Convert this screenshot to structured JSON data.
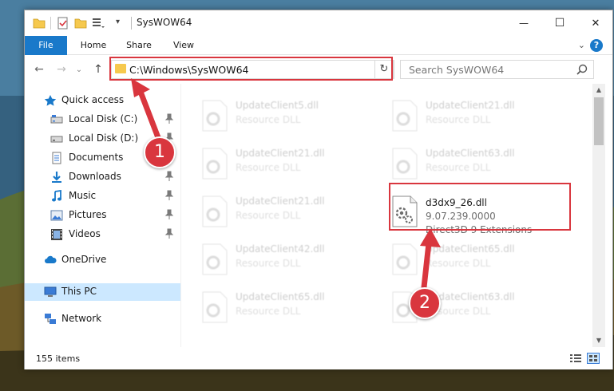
{
  "window": {
    "title": "SysWOW64",
    "minimize_glyph": "—",
    "maximize_glyph": "☐",
    "close_glyph": "✕"
  },
  "ribbon": {
    "tabs": [
      "File",
      "Home",
      "Share",
      "View"
    ],
    "expand_glyph": "⌄",
    "help_glyph": "?"
  },
  "nav": {
    "back_glyph": "←",
    "forward_glyph": "→",
    "recent_glyph": "⌄",
    "up_glyph": "↑",
    "address": "C:\\Windows\\SysWOW64",
    "address_dropdown_glyph": "⌄",
    "refresh_glyph": "↻",
    "search_placeholder": "Search SysWOW64"
  },
  "sidebar": {
    "items": [
      {
        "label": "Quick access",
        "icon": "star-icon"
      },
      {
        "label": "Local Disk (C:)",
        "icon": "drive-icon",
        "pinned": true
      },
      {
        "label": "Local Disk (D:)",
        "icon": "drive-icon",
        "pinned": true
      },
      {
        "label": "Documents",
        "icon": "documents-icon",
        "pinned": true
      },
      {
        "label": "Downloads",
        "icon": "downloads-icon",
        "pinned": true
      },
      {
        "label": "Music",
        "icon": "music-icon",
        "pinned": true
      },
      {
        "label": "Pictures",
        "icon": "pictures-icon",
        "pinned": true
      },
      {
        "label": "Videos",
        "icon": "videos-icon",
        "pinned": true
      },
      {
        "label": "OneDrive",
        "icon": "cloud-icon"
      },
      {
        "label": "This PC",
        "icon": "computer-icon",
        "selected": true
      },
      {
        "label": "Network",
        "icon": "network-icon"
      }
    ]
  },
  "files": [
    {
      "name": "UpdateClient5.dll",
      "type": "Resource DLL",
      "faded": true
    },
    {
      "name": "UpdateClient21.dll",
      "type": "Resource DLL",
      "faded": true
    },
    {
      "name": "UpdateClient21.dll",
      "type": "Resource DLL",
      "faded": true
    },
    {
      "name": "UpdateClient63.dll",
      "type": "Resource DLL",
      "faded": true
    },
    {
      "name": "UpdateClient21.dll",
      "type": "Resource DLL",
      "faded": true
    },
    {
      "name": "d3dx9_26.dll",
      "version": "9.07.239.0000",
      "type": "Direct3D 9 Extensions",
      "faded": false,
      "highlighted": true
    },
    {
      "name": "UpdateClient42.dll",
      "type": "Resource DLL",
      "faded": true
    },
    {
      "name": "UpdateClient65.dll",
      "type": "Resource DLL",
      "faded": true
    },
    {
      "name": "UpdateClient65.dll",
      "type": "Resource DLL",
      "faded": true
    },
    {
      "name": "UpdateClient63.dll",
      "type": "Resource DLL",
      "faded": true
    }
  ],
  "status": {
    "item_count": "155 items"
  },
  "annotations": {
    "step1": "1",
    "step2": "2",
    "color": "#d9363e"
  },
  "colors": {
    "accent": "#1979ca",
    "selection": "#cce8ff",
    "folder": "#f6c94e"
  }
}
